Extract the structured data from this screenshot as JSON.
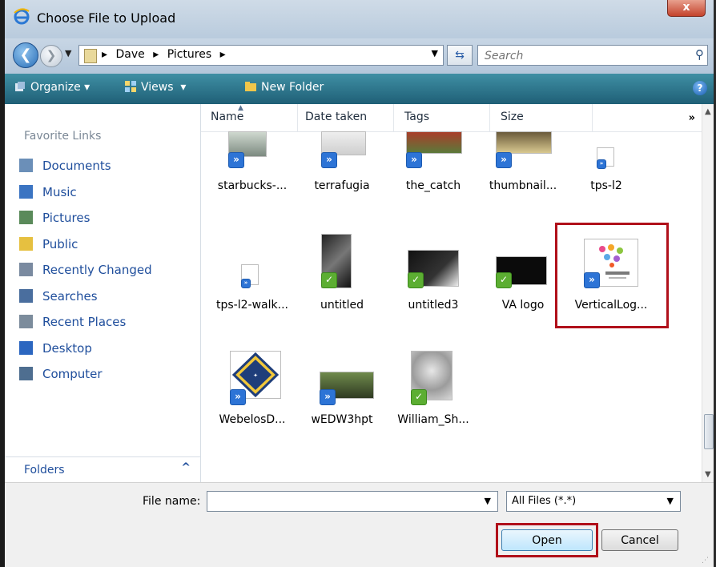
{
  "window": {
    "title": "Choose File to Upload",
    "close_glyph": "x"
  },
  "nav": {
    "back_glyph": "❮",
    "forward_glyph": "❯"
  },
  "address": {
    "breadcrumbs": [
      "Dave",
      "Pictures"
    ],
    "separator": "▸"
  },
  "search": {
    "placeholder": "Search"
  },
  "toolbar": {
    "organize": "Organize",
    "views": "Views",
    "new_folder": "New Folder",
    "help_glyph": "?"
  },
  "sidebar": {
    "header": "Favorite Links",
    "items": [
      {
        "label": "Documents",
        "icon": "documents-icon",
        "color": "#6b8fb8"
      },
      {
        "label": "Music",
        "icon": "music-icon",
        "color": "#3b74c2"
      },
      {
        "label": "Pictures",
        "icon": "pictures-icon",
        "color": "#5a8a5a"
      },
      {
        "label": "Public",
        "icon": "public-folder-icon",
        "color": "#e6c040"
      },
      {
        "label": "Recently Changed",
        "icon": "recently-changed-icon",
        "color": "#7a8aa0"
      },
      {
        "label": "Searches",
        "icon": "searches-icon",
        "color": "#4a6e9e"
      },
      {
        "label": "Recent Places",
        "icon": "recent-places-icon",
        "color": "#7c8c9c"
      },
      {
        "label": "Desktop",
        "icon": "desktop-icon",
        "color": "#2b66c0"
      },
      {
        "label": "Computer",
        "icon": "computer-icon",
        "color": "#4e6e90"
      }
    ],
    "folders_label": "Folders",
    "folders_chevron": "^"
  },
  "columns": {
    "name": "Name",
    "date_taken": "Date taken",
    "tags": "Tags",
    "size": "Size",
    "more": "»"
  },
  "files": [
    {
      "name": "starbucks-...",
      "badge": "blue"
    },
    {
      "name": "terrafugia",
      "badge": "blue"
    },
    {
      "name": "the_catch",
      "badge": "blue"
    },
    {
      "name": "thumbnail...",
      "badge": "blue"
    },
    {
      "name": "tps-l2",
      "badge": "blue"
    },
    {
      "name": "tps-l2-walk...",
      "badge": "blue"
    },
    {
      "name": "untitled",
      "badge": "green"
    },
    {
      "name": "untitled3",
      "badge": "green"
    },
    {
      "name": "VA logo",
      "badge": "green"
    },
    {
      "name": "VerticalLog...",
      "badge": "blue",
      "highlighted": true
    },
    {
      "name": "WebelosD...",
      "badge": "blue"
    },
    {
      "name": "wEDW3hpt",
      "badge": "blue"
    },
    {
      "name": "William_Sh...",
      "badge": "green"
    }
  ],
  "bottom": {
    "file_name_label": "File name:",
    "file_name_value": "",
    "file_type": "All Files (*.*)",
    "open": "Open",
    "cancel": "Cancel"
  },
  "colors": {
    "highlight": "#b0101a",
    "link": "#1f4e9c",
    "toolbar": "#2a6f86"
  }
}
